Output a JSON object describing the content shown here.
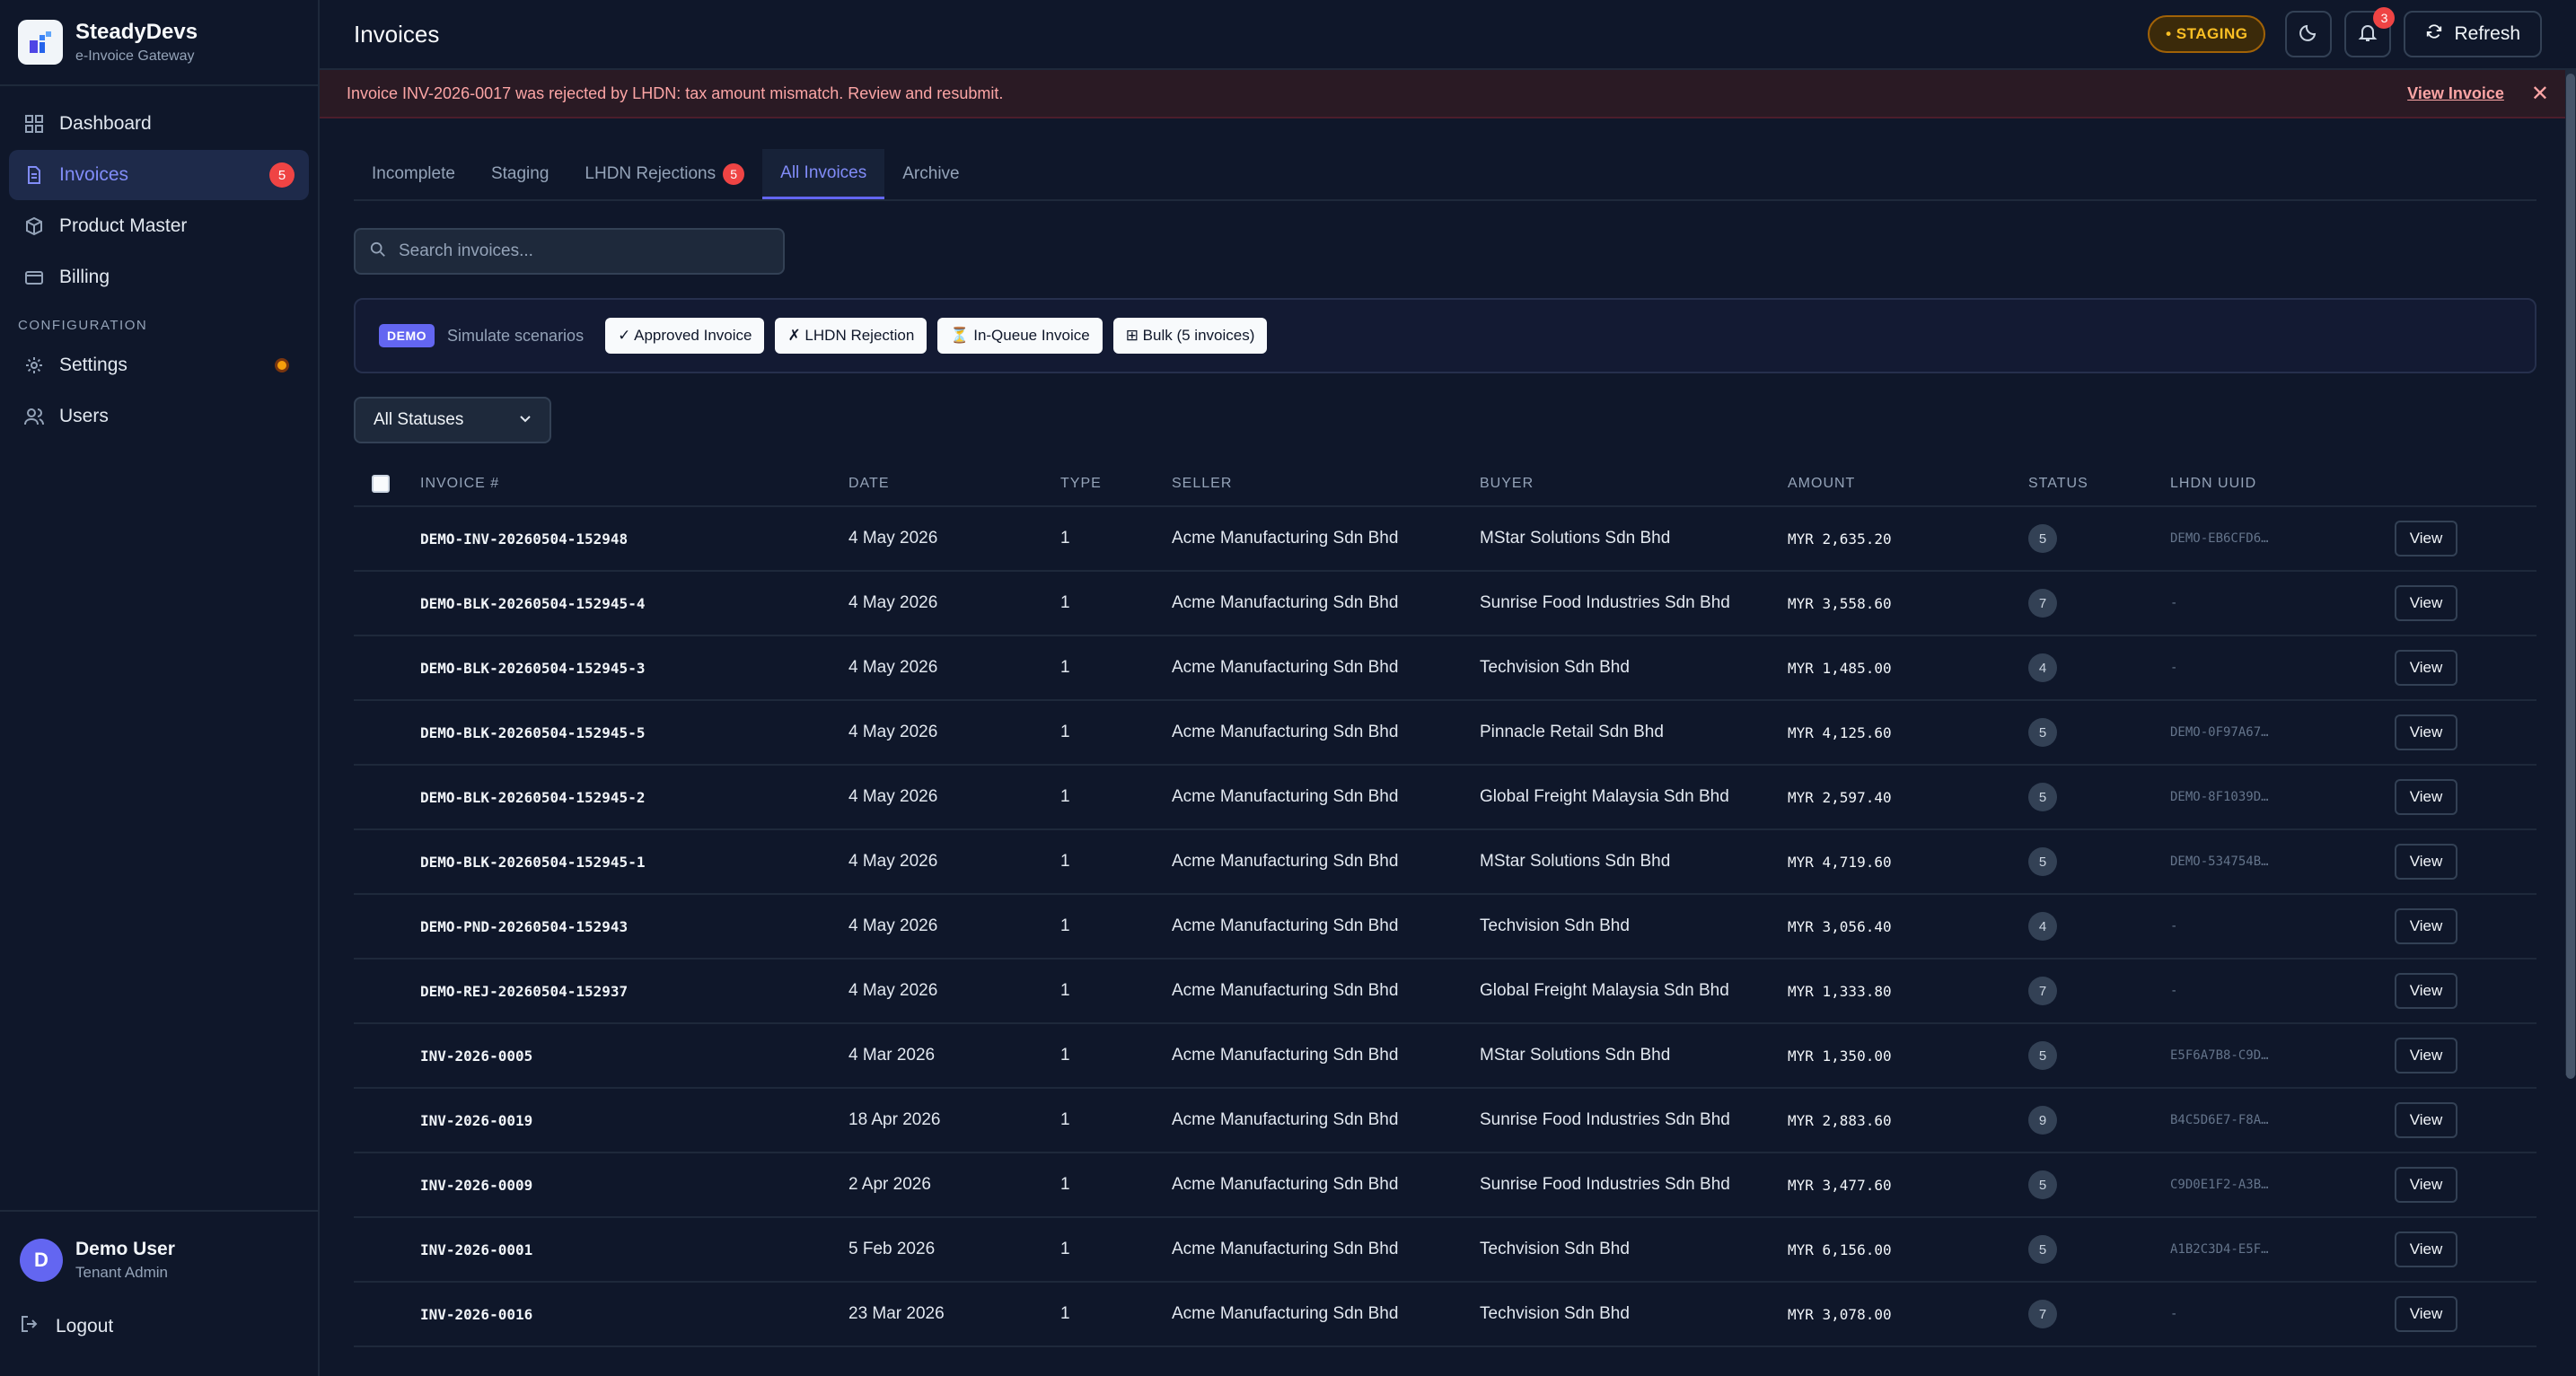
{
  "brand": {
    "name": "SteadyDevs",
    "subtitle": "e-Invoice Gateway"
  },
  "sidebar": {
    "items": [
      {
        "label": "Dashboard",
        "icon": "grid-icon"
      },
      {
        "label": "Invoices",
        "icon": "document-icon",
        "badge": "5",
        "active": true
      },
      {
        "label": "Product Master",
        "icon": "cube-icon"
      },
      {
        "label": "Billing",
        "icon": "card-icon"
      }
    ],
    "section_label": "CONFIGURATION",
    "config_items": [
      {
        "label": "Settings",
        "icon": "gear-icon"
      },
      {
        "label": "Users",
        "icon": "users-icon"
      }
    ]
  },
  "user": {
    "initial": "D",
    "name": "Demo User",
    "role": "Tenant Admin",
    "logout": "Logout"
  },
  "header": {
    "title": "Invoices",
    "env_badge": "• STAGING",
    "notif_count": "3",
    "refresh_label": "Refresh"
  },
  "alert": {
    "message": "Invoice INV-2026-0017 was rejected by LHDN: tax amount mismatch. Review and resubmit.",
    "link": "View Invoice",
    "close": "✕"
  },
  "tabs": [
    {
      "label": "Incomplete"
    },
    {
      "label": "Staging"
    },
    {
      "label": "LHDN Rejections",
      "badge": "5"
    },
    {
      "label": "All Invoices",
      "active": true
    },
    {
      "label": "Archive"
    }
  ],
  "search": {
    "placeholder": "Search invoices..."
  },
  "demo": {
    "tag": "DEMO",
    "label": "Simulate scenarios",
    "buttons": [
      "✓ Approved Invoice",
      "✗ LHDN Rejection",
      "⏳ In-Queue Invoice",
      "⊞ Bulk (5 invoices)"
    ]
  },
  "filter": {
    "selected": "All Statuses"
  },
  "table": {
    "headers": [
      "INVOICE #",
      "DATE",
      "TYPE",
      "SELLER",
      "BUYER",
      "AMOUNT",
      "STATUS",
      "LHDN UUID"
    ],
    "view_label": "View",
    "rows": [
      {
        "invoice": "DEMO-INV-20260504-152948",
        "date": "4 May 2026",
        "type": "1",
        "seller": "Acme Manufacturing Sdn Bhd",
        "buyer": "MStar Solutions Sdn Bhd",
        "amount": "MYR 2,635.20",
        "status": "5",
        "uuid": "DEMO-EB6CFD6…"
      },
      {
        "invoice": "DEMO-BLK-20260504-152945-4",
        "date": "4 May 2026",
        "type": "1",
        "seller": "Acme Manufacturing Sdn Bhd",
        "buyer": "Sunrise Food Industries Sdn Bhd",
        "amount": "MYR 3,558.60",
        "status": "7",
        "uuid": "-"
      },
      {
        "invoice": "DEMO-BLK-20260504-152945-3",
        "date": "4 May 2026",
        "type": "1",
        "seller": "Acme Manufacturing Sdn Bhd",
        "buyer": "Techvision Sdn Bhd",
        "amount": "MYR 1,485.00",
        "status": "4",
        "uuid": "-"
      },
      {
        "invoice": "DEMO-BLK-20260504-152945-5",
        "date": "4 May 2026",
        "type": "1",
        "seller": "Acme Manufacturing Sdn Bhd",
        "buyer": "Pinnacle Retail Sdn Bhd",
        "amount": "MYR 4,125.60",
        "status": "5",
        "uuid": "DEMO-0F97A67…"
      },
      {
        "invoice": "DEMO-BLK-20260504-152945-2",
        "date": "4 May 2026",
        "type": "1",
        "seller": "Acme Manufacturing Sdn Bhd",
        "buyer": "Global Freight Malaysia Sdn Bhd",
        "amount": "MYR 2,597.40",
        "status": "5",
        "uuid": "DEMO-8F1039D…"
      },
      {
        "invoice": "DEMO-BLK-20260504-152945-1",
        "date": "4 May 2026",
        "type": "1",
        "seller": "Acme Manufacturing Sdn Bhd",
        "buyer": "MStar Solutions Sdn Bhd",
        "amount": "MYR 4,719.60",
        "status": "5",
        "uuid": "DEMO-534754B…"
      },
      {
        "invoice": "DEMO-PND-20260504-152943",
        "date": "4 May 2026",
        "type": "1",
        "seller": "Acme Manufacturing Sdn Bhd",
        "buyer": "Techvision Sdn Bhd",
        "amount": "MYR 3,056.40",
        "status": "4",
        "uuid": "-"
      },
      {
        "invoice": "DEMO-REJ-20260504-152937",
        "date": "4 May 2026",
        "type": "1",
        "seller": "Acme Manufacturing Sdn Bhd",
        "buyer": "Global Freight Malaysia Sdn Bhd",
        "amount": "MYR 1,333.80",
        "status": "7",
        "uuid": "-"
      },
      {
        "invoice": "INV-2026-0005",
        "date": "4 Mar 2026",
        "type": "1",
        "seller": "Acme Manufacturing Sdn Bhd",
        "buyer": "MStar Solutions Sdn Bhd",
        "amount": "MYR 1,350.00",
        "status": "5",
        "uuid": "E5F6A7B8-C9D…"
      },
      {
        "invoice": "INV-2026-0019",
        "date": "18 Apr 2026",
        "type": "1",
        "seller": "Acme Manufacturing Sdn Bhd",
        "buyer": "Sunrise Food Industries Sdn Bhd",
        "amount": "MYR 2,883.60",
        "status": "9",
        "uuid": "B4C5D6E7-F8A…"
      },
      {
        "invoice": "INV-2026-0009",
        "date": "2 Apr 2026",
        "type": "1",
        "seller": "Acme Manufacturing Sdn Bhd",
        "buyer": "Sunrise Food Industries Sdn Bhd",
        "amount": "MYR 3,477.60",
        "status": "5",
        "uuid": "C9D0E1F2-A3B…"
      },
      {
        "invoice": "INV-2026-0001",
        "date": "5 Feb 2026",
        "type": "1",
        "seller": "Acme Manufacturing Sdn Bhd",
        "buyer": "Techvision Sdn Bhd",
        "amount": "MYR 6,156.00",
        "status": "5",
        "uuid": "A1B2C3D4-E5F…"
      },
      {
        "invoice": "INV-2026-0016",
        "date": "23 Mar 2026",
        "type": "1",
        "seller": "Acme Manufacturing Sdn Bhd",
        "buyer": "Techvision Sdn Bhd",
        "amount": "MYR 3,078.00",
        "status": "7",
        "uuid": "-"
      }
    ]
  }
}
